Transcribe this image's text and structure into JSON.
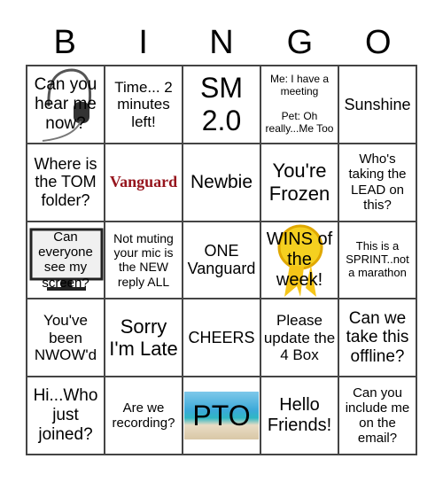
{
  "header": [
    "B",
    "I",
    "N",
    "G",
    "O"
  ],
  "cells": [
    {
      "text": "Can you hear me now?",
      "size": 19,
      "image": "headset-icon"
    },
    {
      "text": "Time... 2 minutes left!",
      "size": 17
    },
    {
      "text": "SM 2.0",
      "size": 32
    },
    {
      "text": "Me: I have a meeting\n\nPet: Oh really...Me Too",
      "size": 12
    },
    {
      "text": "Sunshine",
      "size": 18
    },
    {
      "text": "Where is the TOM folder?",
      "size": 18
    },
    {
      "text": "Vanguard",
      "size": 18,
      "logo": true,
      "color": "#96151d"
    },
    {
      "text": "Newbie",
      "size": 21
    },
    {
      "text": "You're Frozen",
      "size": 22
    },
    {
      "text": "Who's taking the LEAD on this?",
      "size": 15
    },
    {
      "text": "Can everyone see my screen?",
      "size": 15,
      "image": "monitor-icon"
    },
    {
      "text": "Not muting your mic is the NEW reply ALL",
      "size": 14
    },
    {
      "text": "ONE Vanguard",
      "size": 18
    },
    {
      "text": "WINS of the week!",
      "size": 20,
      "image": "award-ribbon-icon"
    },
    {
      "text": "This is a SPRINT..not a marathon",
      "size": 13
    },
    {
      "text": "You've been NWOW'd",
      "size": 17
    },
    {
      "text": "Sorry I'm Late",
      "size": 22
    },
    {
      "text": "CHEERS",
      "size": 18
    },
    {
      "text": "Please update the 4 Box",
      "size": 17
    },
    {
      "text": "Can we take this offline?",
      "size": 19
    },
    {
      "text": "Hi...Who just joined?",
      "size": 19
    },
    {
      "text": "Are we recording?",
      "size": 15
    },
    {
      "text": "PTO",
      "size": 32,
      "image": "beach-photo"
    },
    {
      "text": "Hello Friends!",
      "size": 20
    },
    {
      "text": "Can you include me on the email?",
      "size": 15
    }
  ]
}
